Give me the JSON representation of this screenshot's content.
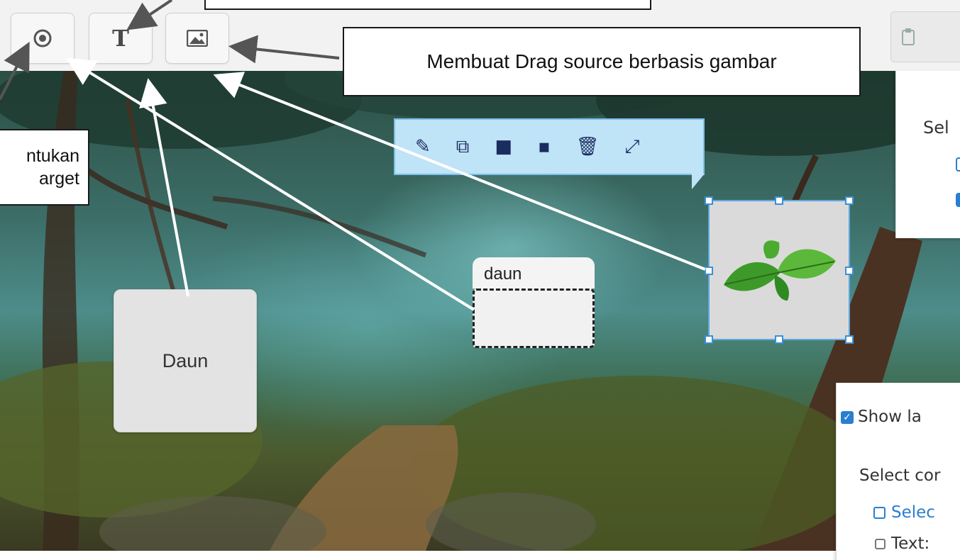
{
  "toolbar": {
    "buttons": [
      {
        "name": "drop-target-tool",
        "icon": "target-icon",
        "glyph": "◎"
      },
      {
        "name": "text-tool",
        "icon": "text-icon",
        "glyph": "T"
      },
      {
        "name": "image-tool",
        "icon": "image-icon",
        "glyph": "🖼"
      }
    ],
    "paste_icon": "clipboard-icon"
  },
  "callouts": {
    "image_source": "Membuat Drag source berbasis gambar",
    "drop_target_line1": "ntukan",
    "drop_target_line2": "arget"
  },
  "element_toolbar": {
    "icons": [
      "pencil-icon",
      "copy-icon",
      "bring-front-icon",
      "send-back-icon",
      "trash-icon",
      "expand-icon"
    ],
    "glyphs": [
      "✎",
      "⧉",
      "■",
      "▪",
      "🗑",
      "⤢"
    ]
  },
  "canvas": {
    "drop_target_label": "daun",
    "text_source_label": "Daun",
    "image_source_content": "basil-leaf-image"
  },
  "panels": {
    "top_heading": "Sel",
    "show_label": "Show la",
    "select_correct": "Select cor",
    "select_all": "Selec",
    "text_option": "Text:"
  },
  "colors": {
    "selection_blue": "#3d8fd3",
    "toolbar_bubble": "#bfe3f7",
    "checkbox_blue": "#2a7ecf"
  }
}
